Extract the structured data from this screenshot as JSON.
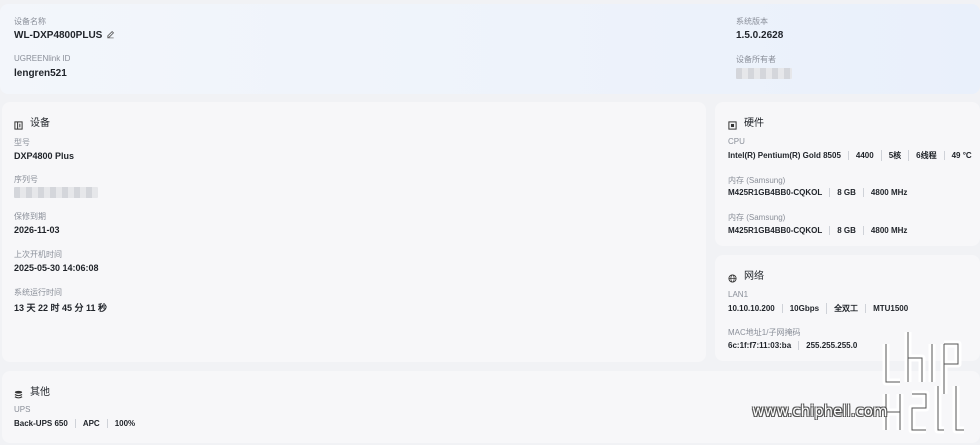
{
  "header": {
    "device_name_label": "设备名称",
    "device_name": "WL-DXP4800PLUS",
    "ugreen_id_label": "UGREENlink ID",
    "ugreen_id": "lengren521",
    "system_version_label": "系统版本",
    "system_version": "1.5.0.2628",
    "owner_label": "设备所有者"
  },
  "device": {
    "title": "设备",
    "model_label": "型号",
    "model": "DXP4800 Plus",
    "serial_label": "序列号",
    "serial_partial": "E075...",
    "warranty_label": "保修到期",
    "warranty": "2026-11-03",
    "last_boot_label": "上次开机时间",
    "last_boot": "2025-05-30 14:06:08",
    "uptime_label": "系统运行时间",
    "uptime": "13 天 22 时 45 分 11 秒"
  },
  "hardware": {
    "title": "硬件",
    "cpu_label": "CPU",
    "cpu": [
      "Intel(R) Pentium(R) Gold 8505",
      "4400",
      "5核",
      "6线程",
      "49 °C"
    ],
    "memory1_label": "内存 (Samsung)",
    "memory1": [
      "M425R1GB4BB0-CQKOL",
      "8 GB",
      "4800 MHz"
    ],
    "memory2_label": "内存 (Samsung)",
    "memory2": [
      "M425R1GB4BB0-CQKOL",
      "8 GB",
      "4800 MHz"
    ]
  },
  "network": {
    "title": "网络",
    "lan_label": "LAN1",
    "lan": [
      "10.10.10.200",
      "10Gbps",
      "全双工",
      "MTU1500"
    ],
    "mac_label": "MAC地址1/子网掩码",
    "mac": [
      "6c:1f:f7:11:03:ba",
      "255.255.255.0"
    ]
  },
  "other": {
    "title": "其他",
    "ups_label": "UPS",
    "ups": [
      "Back-UPS 650",
      "APC",
      "100%"
    ]
  },
  "watermark": {
    "text": "www.chiphell.com"
  }
}
